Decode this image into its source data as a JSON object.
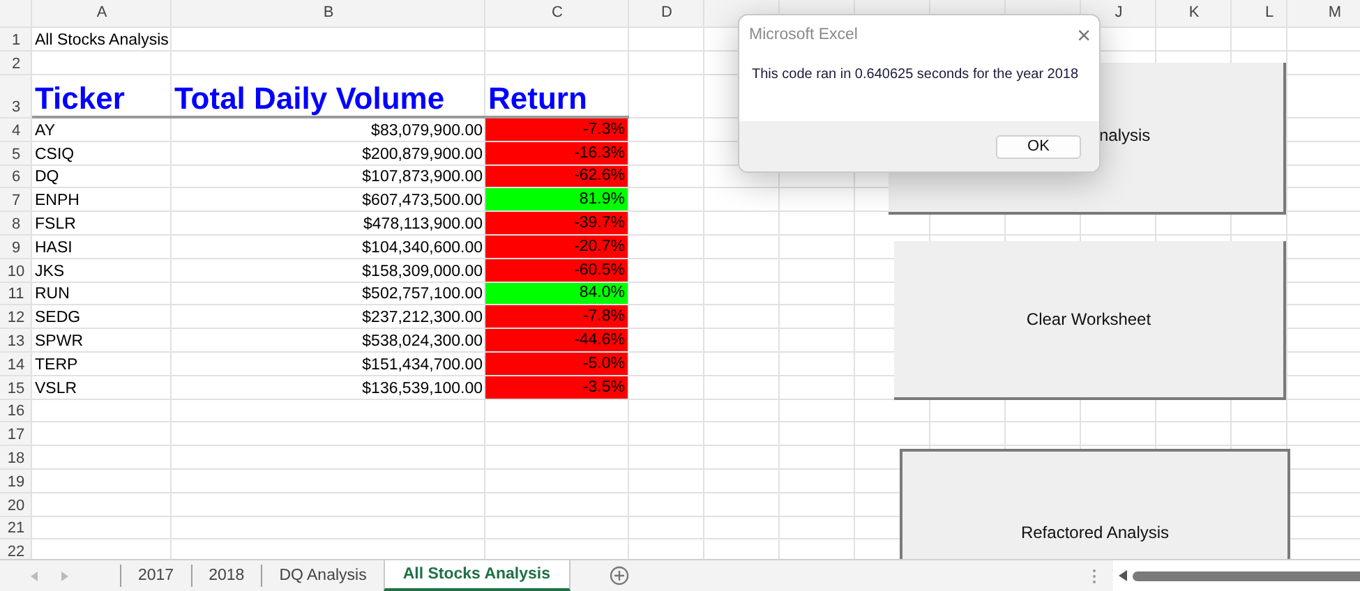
{
  "sheet": {
    "columns_left": [
      "A",
      "B",
      "C",
      "D"
    ],
    "columns_right": [
      "J",
      "K",
      "L",
      "M"
    ],
    "row_numbers": [
      "1",
      "2",
      "3",
      "4",
      "5",
      "6",
      "7",
      "8",
      "9",
      "10",
      "11",
      "12",
      "13",
      "14",
      "15",
      "16",
      "17",
      "18",
      "19",
      "20",
      "21",
      "22"
    ],
    "title": "All Stocks Analysis",
    "headers": [
      "Ticker",
      "Total Daily Volume",
      "Return"
    ],
    "rows": [
      {
        "ticker": "AY",
        "volume": "$83,079,900.00",
        "return": "-7.3%",
        "color": "#ff0000"
      },
      {
        "ticker": "CSIQ",
        "volume": "$200,879,900.00",
        "return": "-16.3%",
        "color": "#ff0000"
      },
      {
        "ticker": "DQ",
        "volume": "$107,873,900.00",
        "return": "-62.6%",
        "color": "#ff0000"
      },
      {
        "ticker": "ENPH",
        "volume": "$607,473,500.00",
        "return": "81.9%",
        "color": "#00ff00"
      },
      {
        "ticker": "FSLR",
        "volume": "$478,113,900.00",
        "return": "-39.7%",
        "color": "#ff0000"
      },
      {
        "ticker": "HASI",
        "volume": "$104,340,600.00",
        "return": "-20.7%",
        "color": "#ff0000"
      },
      {
        "ticker": "JKS",
        "volume": "$158,309,000.00",
        "return": "-60.5%",
        "color": "#ff0000"
      },
      {
        "ticker": "RUN",
        "volume": "$502,757,100.00",
        "return": "84.0%",
        "color": "#00ff00"
      },
      {
        "ticker": "SEDG",
        "volume": "$237,212,300.00",
        "return": "-7.8%",
        "color": "#ff0000"
      },
      {
        "ticker": "SPWR",
        "volume": "$538,024,300.00",
        "return": "-44.6%",
        "color": "#ff0000"
      },
      {
        "ticker": "TERP",
        "volume": "$151,434,700.00",
        "return": "-5.0%",
        "color": "#ff0000"
      },
      {
        "ticker": "VSLR",
        "volume": "$136,539,100.00",
        "return": "-3.5%",
        "color": "#ff0000"
      }
    ]
  },
  "macro_buttons": [
    {
      "label": "nalysis"
    },
    {
      "label": "Clear Worksheet"
    },
    {
      "label": "Refactored Analysis"
    }
  ],
  "dialog": {
    "title": "Microsoft Excel",
    "close": "×",
    "message": "This code ran in 0.640625 seconds for the year 2018",
    "button": "OK"
  },
  "tabs": [
    {
      "label": "2017",
      "selected": false
    },
    {
      "label": "2018",
      "selected": false
    },
    {
      "label": "DQ Analysis",
      "selected": false
    },
    {
      "label": "All Stocks Analysis",
      "selected": true
    }
  ]
}
